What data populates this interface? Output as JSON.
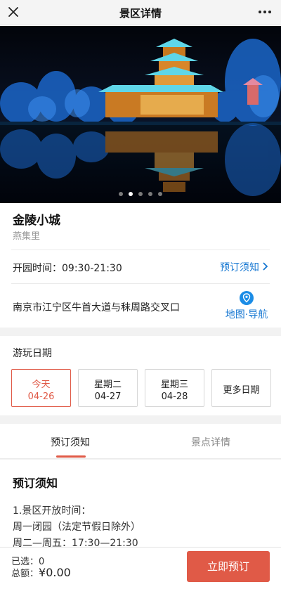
{
  "header": {
    "title": "景区详情"
  },
  "carousel": {
    "total": 5,
    "active_index": 1
  },
  "attraction": {
    "name": "金陵小城",
    "subname": "燕集里",
    "hours": "开园时间：09:30-21:30",
    "notice_link": "预订须知",
    "address": "南京市江宁区牛首大道与秣周路交叉口",
    "map_label": "地图·导航"
  },
  "dates": {
    "title": "游玩日期",
    "items": [
      {
        "day": "今天",
        "date": "04-26",
        "selected": true
      },
      {
        "day": "星期二",
        "date": "04-27",
        "selected": false
      },
      {
        "day": "星期三",
        "date": "04-28",
        "selected": false
      }
    ],
    "more": "更多日期"
  },
  "tabs": [
    {
      "label": "预订须知",
      "active": true
    },
    {
      "label": "景点详情",
      "active": false
    }
  ],
  "content": {
    "title": "预订须知",
    "lines": [
      "1.景区开放时间：",
      "周一闭园（法定节假日除外）",
      "周二—周五：17:30—21:30"
    ]
  },
  "bottom": {
    "selected": "已选：0",
    "total_label": "总额：",
    "total_amount": "¥0.00",
    "book_label": "立即预订"
  },
  "colors": {
    "accent": "#e05a47",
    "link": "#1677d2"
  }
}
